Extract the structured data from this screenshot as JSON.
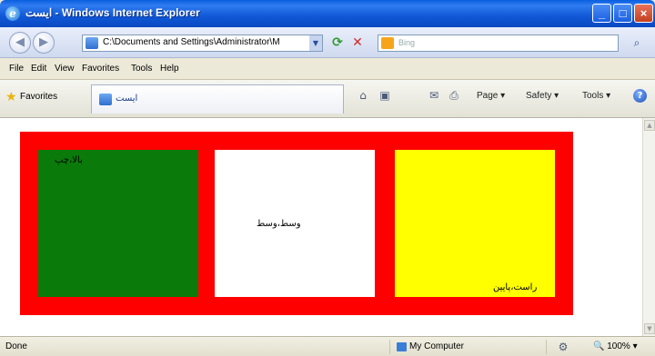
{
  "window": {
    "title": "ایست - Windows Internet Explorer",
    "colors": {
      "titlebar": "#0a5fe0",
      "close_button": "#c4401f"
    }
  },
  "address_bar": {
    "url": "C:\\Documents and Settings\\Administrator\\M",
    "search_placeholder": "Bing"
  },
  "menu": {
    "items": [
      "File",
      "Edit",
      "View",
      "Favorites",
      "Tools",
      "Help"
    ]
  },
  "favorites_bar": {
    "favorites_label": "Favorites",
    "tab_label": "ایست",
    "commands": [
      "Page ▾",
      "Safety ▾",
      "Tools ▾"
    ]
  },
  "content": {
    "colors": {
      "outer": "#ff0000",
      "left": "#0a7a0a",
      "middle": "#ffffff",
      "right": "#ffff00"
    },
    "panels": [
      {
        "text": "بالا،چپ"
      },
      {
        "text": "وسط،وسط"
      },
      {
        "text": "راست،پایین"
      }
    ]
  },
  "status_bar": {
    "status": "Done",
    "zone": "My Computer",
    "zoom": "100%"
  }
}
